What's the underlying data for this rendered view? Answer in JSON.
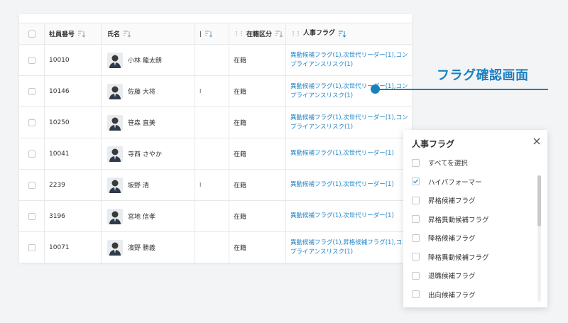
{
  "table": {
    "headers": {
      "employee_id": "社員番号",
      "name": "氏名",
      "status": "在籍区分",
      "hr_flag": "人事フラグ"
    },
    "rows": [
      {
        "id": "10010",
        "name": "小林 龍太朗",
        "status": "在籍",
        "flags": "異動候補フラグ(1),次世代リーダー(1),コンプライアンスリスク(1)",
        "mid": ""
      },
      {
        "id": "10146",
        "name": "佐藤 大将",
        "status": "在籍",
        "flags": "異動候補フラグ(1),次世代リーダー(1),コンプライアンスリスク(1)",
        "mid": "I"
      },
      {
        "id": "10250",
        "name": "笹森 直美",
        "status": "在籍",
        "flags": "異動候補フラグ(1),次世代リーダー(1),コンプライアンスリスク(1)",
        "mid": ""
      },
      {
        "id": "10041",
        "name": "寺西 さやか",
        "status": "在籍",
        "flags": "異動候補フラグ(1),次世代リーダー(1)",
        "mid": ""
      },
      {
        "id": "2239",
        "name": "坂野 清",
        "status": "在籍",
        "flags": "異動候補フラグ(1),次世代リーダー(1)",
        "mid": "I"
      },
      {
        "id": "3196",
        "name": "宮地 信孝",
        "status": "在籍",
        "flags": "異動候補フラグ(1),次世代リーダー(1)",
        "mid": ""
      },
      {
        "id": "10071",
        "name": "濱野 勝義",
        "status": "在籍",
        "flags": "異動候補フラグ(1),昇格候補フラグ(1),コンプライアンスリスク(1)",
        "mid": ""
      }
    ]
  },
  "callout": {
    "label": "フラグ確認画面"
  },
  "filter_panel": {
    "title": "人事フラグ",
    "options": [
      {
        "label": "すべてを選択",
        "checked": false
      },
      {
        "label": "ハイパフォーマー",
        "checked": true
      },
      {
        "label": "昇格候補フラグ",
        "checked": false
      },
      {
        "label": "昇格異動候補フラグ",
        "checked": false
      },
      {
        "label": "降格候補フラグ",
        "checked": false
      },
      {
        "label": "降格異動候補フラグ",
        "checked": false
      },
      {
        "label": "退職候補フラグ",
        "checked": false
      },
      {
        "label": "出向候補フラグ",
        "checked": false
      }
    ]
  },
  "colors": {
    "accent": "#1a7fc1",
    "link": "#2386c8",
    "check": "#2ba6d8"
  }
}
